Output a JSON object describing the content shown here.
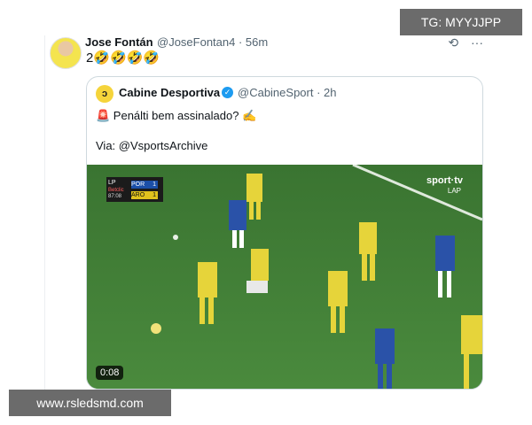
{
  "tweet": {
    "author_name": "Jose Fontán",
    "author_meta": "@JoseFontan4 · 56m",
    "text": "2🤣🤣🤣🤣"
  },
  "quote": {
    "avatar_glyph": "ↄ",
    "author_name": "Cabine Desportiva",
    "author_meta": "@CabineSport · 2h",
    "line1": "🚨 Penálti bem assinalado? ✍",
    "line2": "Via: @VsportsArchive"
  },
  "video": {
    "duration": "0:08",
    "scorebug": {
      "league": "LP",
      "sponsor": "Betclic",
      "time": "87:08",
      "team1": "POR",
      "score1": "1",
      "team2": "ARO",
      "score2": "1"
    },
    "broadcaster": "sport·tv",
    "broadcaster_sub": "LAP"
  },
  "watermarks": {
    "top": "TG: MYYJJPP",
    "bottom": "www.rsledsmd.com"
  },
  "colors": {
    "link": "#1d9bf0",
    "pitch": "#3f7b36",
    "yellow_kit": "#e6d43a",
    "blue_kit": "#2a52a8"
  },
  "icons": [
    "grok-icon",
    "more-icon",
    "verified-icon"
  ]
}
